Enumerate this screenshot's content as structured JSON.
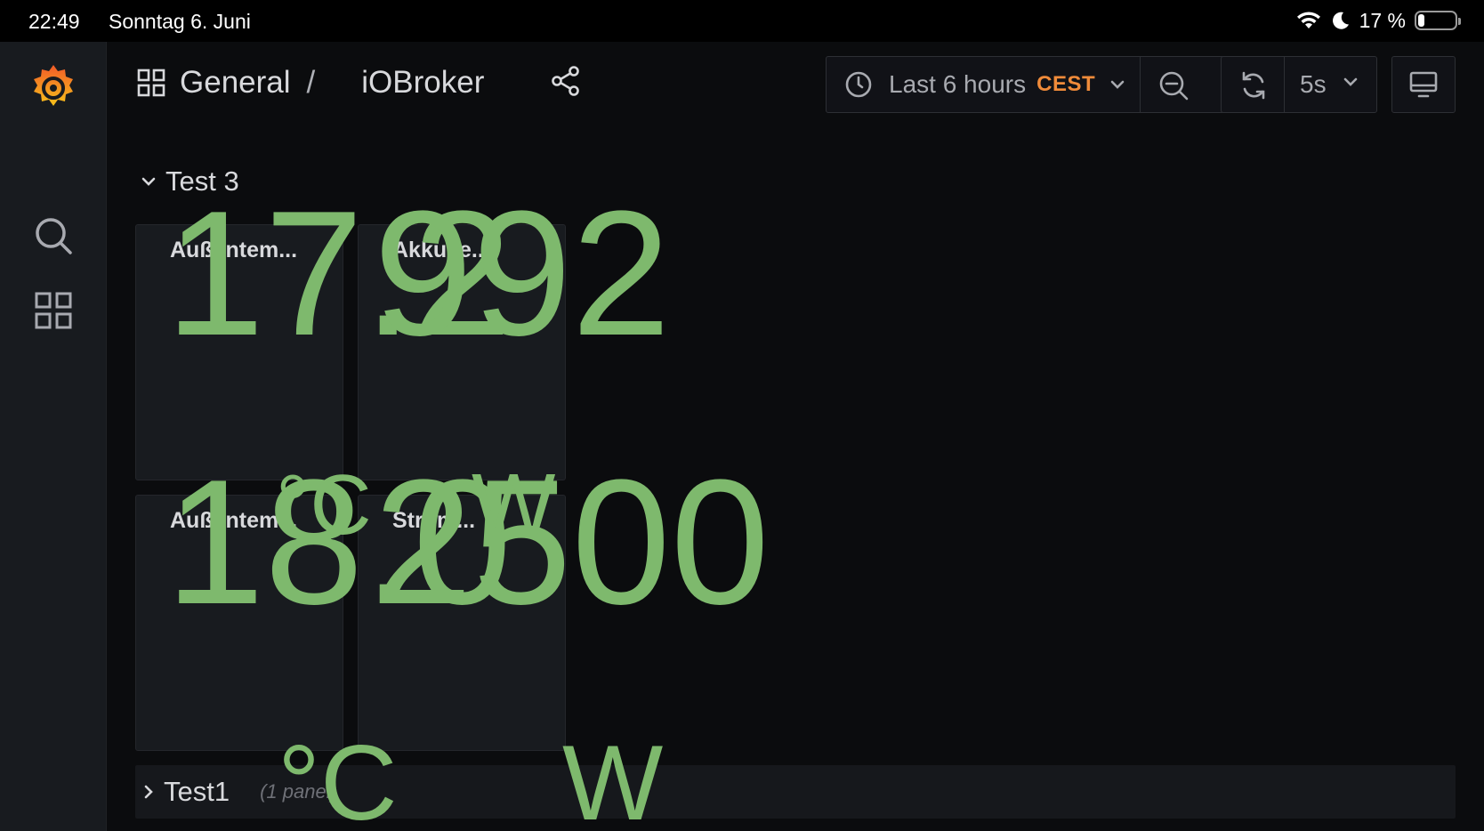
{
  "status_bar": {
    "time": "22:49",
    "date": "Sonntag 6. Juni",
    "battery_text": "17 %",
    "battery_level": 0.17
  },
  "breadcrumb": {
    "folder": "General",
    "separator": "/",
    "dashboard": "iOBroker"
  },
  "time_picker": {
    "label": "Last 6 hours",
    "timezone": "CEST"
  },
  "refresh": {
    "interval": "5s"
  },
  "icons": {
    "logo": "grafana-logo-icon",
    "search": "search-icon",
    "dashboards": "dashboards-grid-icon",
    "share": "share-icon",
    "clock": "clock-icon",
    "zoom_out": "zoom-out-icon",
    "refresh": "refresh-icon",
    "kiosk": "monitor-icon"
  },
  "colors": {
    "value": "#7eb96d",
    "accent": "#f08b3a",
    "background": "#0b0c0e",
    "panel": "#181b1f"
  },
  "rows": [
    {
      "title": "Test 3",
      "panels": [
        {
          "title": "Außentem...",
          "value": "17.2",
          "unit": "°C"
        },
        {
          "title": "Akku le...",
          "value": "992",
          "unit": ""
        },
        {
          "title": "Außentem...",
          "value": "18.0",
          "unit": "°C"
        },
        {
          "title": "Strom...",
          "value": "2500",
          "unit": "W"
        }
      ]
    },
    {
      "title": "Test1",
      "meta": "(1 panel)"
    }
  ]
}
